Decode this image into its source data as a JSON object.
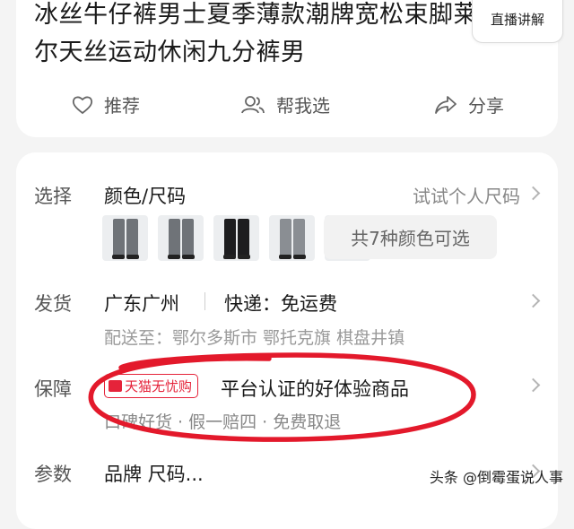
{
  "product": {
    "title_line1": "冰丝牛仔裤男士夏季薄款潮牌宽松束脚莱赛",
    "title_line2": "尔天丝运动休闲九分裤男",
    "live_badge_label": "直播讲解"
  },
  "actions": [
    {
      "label": "推荐",
      "icon": "heart-icon"
    },
    {
      "label": "帮我选",
      "icon": "users-icon"
    },
    {
      "label": "分享",
      "icon": "share-icon"
    }
  ],
  "select": {
    "label": "选择",
    "value": "颜色/尺码",
    "try_size": "试试个人尺码",
    "colors_button": "共7种颜色可选",
    "thumbnails": [
      {
        "color": "#6f7378"
      },
      {
        "color": "#6f7378"
      },
      {
        "color": "#1d1d1f"
      },
      {
        "color": "#8a8e93"
      },
      {
        "color": "#2a2a2c"
      }
    ]
  },
  "shipping": {
    "label": "发货",
    "location": "广东广州",
    "express": "快递：免运费",
    "deliver_to": "配送至：鄂尔多斯市 鄂托克旗 棋盘井镇"
  },
  "guarantee": {
    "label": "保障",
    "badge": "天猫无忧购",
    "text": "平台认证的好体验商品",
    "sub": "口碑好货 · 假一赔四 · 免费取退"
  },
  "params": {
    "label": "参数",
    "value": "品牌 尺码..."
  },
  "watermark": "头条 @倒霉蛋说人事",
  "colors": {
    "accent_red": "#e5233a",
    "annotation_red": "#e3192b",
    "live_pink": "#ff3d6b"
  }
}
